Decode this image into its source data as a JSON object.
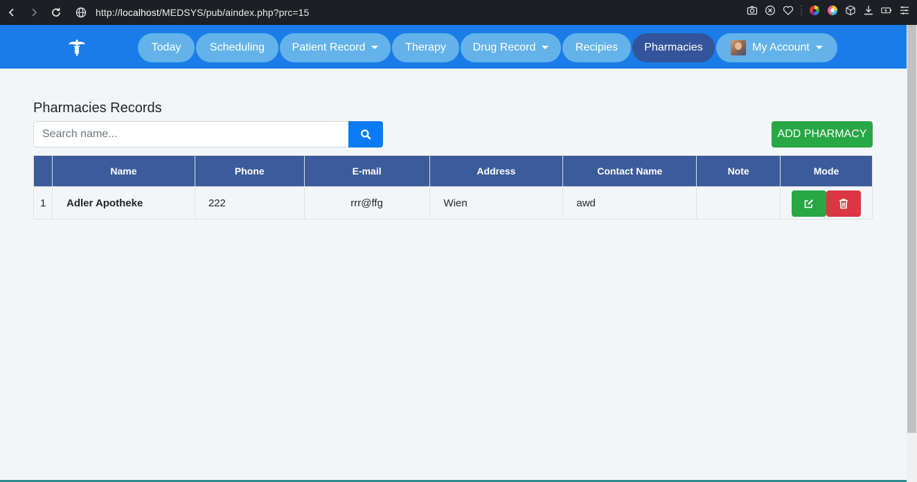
{
  "browser": {
    "url_prefix": "http://",
    "url_host": "localhost",
    "url_path": "/MEDSYS/pub/aindex.php?prc=15",
    "icons": [
      "back-icon",
      "forward-icon",
      "reload-icon",
      "site-info-icon",
      "camera-icon",
      "block-icon",
      "heart-icon",
      "color-wheel-icon",
      "palette-icon",
      "cube-icon",
      "download-icon",
      "battery-icon",
      "menu-icon"
    ]
  },
  "navbar": {
    "brand_icon": "caduceus-icon",
    "items": [
      {
        "label": "Today",
        "active": false,
        "dropdown": false
      },
      {
        "label": "Scheduling",
        "active": false,
        "dropdown": false
      },
      {
        "label": "Patient Record",
        "active": false,
        "dropdown": true
      },
      {
        "label": "Therapy",
        "active": false,
        "dropdown": false
      },
      {
        "label": "Drug Record",
        "active": false,
        "dropdown": true
      },
      {
        "label": "Recipies",
        "active": false,
        "dropdown": false
      },
      {
        "label": "Pharmacies",
        "active": true,
        "dropdown": false
      },
      {
        "label": "My Account",
        "active": false,
        "dropdown": true
      }
    ]
  },
  "page": {
    "title": "Pharmacies Records",
    "search": {
      "placeholder": "Search name...",
      "value": ""
    },
    "add_button": "ADD PHARMACY"
  },
  "table": {
    "headers": [
      "",
      "Name",
      "Phone",
      "E-mail",
      "Address",
      "Contact Name",
      "Note",
      "Mode"
    ],
    "rows": [
      {
        "num": "1",
        "name": "Adler Apotheke",
        "phone": "222",
        "email": "rrr@ffg",
        "address": "Wien",
        "contact": "awd",
        "note": ""
      }
    ]
  },
  "colors": {
    "navbar": "#1a7ce8",
    "pill": "#63b3ea",
    "pill_active": "#33539a",
    "table_header": "#3b5b9b",
    "success": "#28a745",
    "danger": "#dc3545",
    "primary": "#0b7bf5"
  }
}
